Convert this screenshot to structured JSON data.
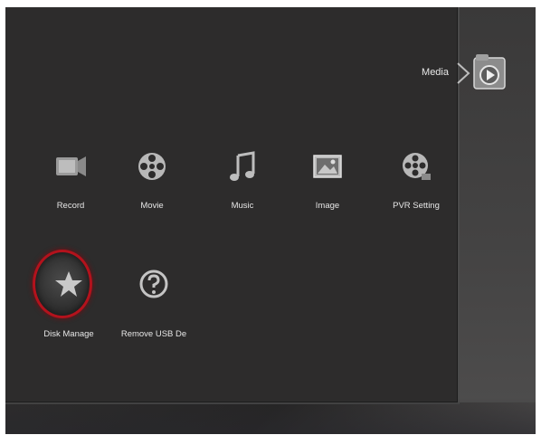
{
  "header": {
    "section_title": "Media"
  },
  "colors": {
    "focus_ring": "#b3121c",
    "panel": "#2d2c2c",
    "text": "#e6e6e6"
  },
  "menu": {
    "items": [
      {
        "label": "Record",
        "icon": "camera-icon"
      },
      {
        "label": "Movie",
        "icon": "film-reel-icon"
      },
      {
        "label": "Music",
        "icon": "music-note-icon"
      },
      {
        "label": "Image",
        "icon": "picture-icon"
      },
      {
        "label": "PVR Setting",
        "icon": "reel-settings-icon"
      },
      {
        "label": "Disk Manage",
        "icon": "star-icon",
        "selected": true
      },
      {
        "label": "Remove USB De",
        "icon": "help-icon"
      }
    ]
  }
}
